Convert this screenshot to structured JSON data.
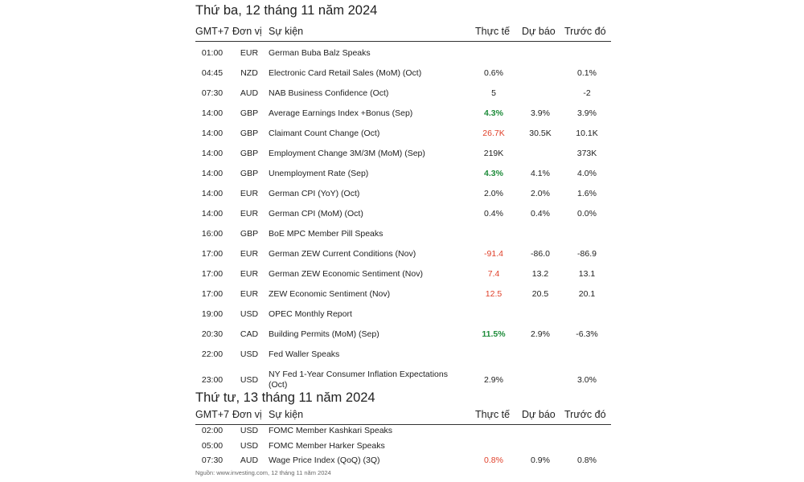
{
  "day1": {
    "title": "Thứ ba, 12 tháng 11 năm 2024",
    "headers": {
      "time": "GMT+7",
      "unit": "Đơn vị",
      "event": "Sự kiện",
      "actual": "Thực tế",
      "forecast": "Dự báo",
      "previous": "Trước đó"
    },
    "rows": [
      {
        "time": "01:00",
        "unit": "EUR",
        "event": "German Buba Balz Speaks",
        "actual": "",
        "actual_trend": "",
        "forecast": "",
        "previous": ""
      },
      {
        "time": "04:45",
        "unit": "NZD",
        "event": "Electronic Card Retail Sales (MoM) (Oct)",
        "actual": "0.6%",
        "actual_trend": "",
        "forecast": "",
        "previous": "0.1%"
      },
      {
        "time": "07:30",
        "unit": "AUD",
        "event": "NAB Business Confidence (Oct)",
        "actual": "5",
        "actual_trend": "",
        "forecast": "",
        "previous": "-2"
      },
      {
        "time": "14:00",
        "unit": "GBP",
        "event": "Average Earnings Index +Bonus (Sep)",
        "actual": "4.3%",
        "actual_trend": "up",
        "forecast": "3.9%",
        "previous": "3.9%"
      },
      {
        "time": "14:00",
        "unit": "GBP",
        "event": "Claimant Count Change (Oct)",
        "actual": "26.7K",
        "actual_trend": "down",
        "forecast": "30.5K",
        "previous": "10.1K"
      },
      {
        "time": "14:00",
        "unit": "GBP",
        "event": "Employment Change 3M/3M (MoM) (Sep)",
        "actual": "219K",
        "actual_trend": "",
        "forecast": "",
        "previous": "373K"
      },
      {
        "time": "14:00",
        "unit": "GBP",
        "event": "Unemployment Rate (Sep)",
        "actual": "4.3%",
        "actual_trend": "up",
        "forecast": "4.1%",
        "previous": "4.0%"
      },
      {
        "time": "14:00",
        "unit": "EUR",
        "event": "German CPI (YoY) (Oct)",
        "actual": "2.0%",
        "actual_trend": "",
        "forecast": "2.0%",
        "previous": "1.6%"
      },
      {
        "time": "14:00",
        "unit": "EUR",
        "event": "German CPI (MoM) (Oct)",
        "actual": "0.4%",
        "actual_trend": "",
        "forecast": "0.4%",
        "previous": "0.0%"
      },
      {
        "time": "16:00",
        "unit": "GBP",
        "event": "BoE MPC Member Pill Speaks",
        "actual": "",
        "actual_trend": "",
        "forecast": "",
        "previous": ""
      },
      {
        "time": "17:00",
        "unit": "EUR",
        "event": "German ZEW Current Conditions (Nov)",
        "actual": "-91.4",
        "actual_trend": "down",
        "forecast": "-86.0",
        "previous": "-86.9"
      },
      {
        "time": "17:00",
        "unit": "EUR",
        "event": "German ZEW Economic Sentiment (Nov)",
        "actual": "7.4",
        "actual_trend": "down",
        "forecast": "13.2",
        "previous": "13.1"
      },
      {
        "time": "17:00",
        "unit": "EUR",
        "event": "ZEW Economic Sentiment (Nov)",
        "actual": "12.5",
        "actual_trend": "down",
        "forecast": "20.5",
        "previous": "20.1"
      },
      {
        "time": "19:00",
        "unit": "USD",
        "event": "OPEC Monthly Report",
        "actual": "",
        "actual_trend": "",
        "forecast": "",
        "previous": ""
      },
      {
        "time": "20:30",
        "unit": "CAD",
        "event": "Building Permits (MoM) (Sep)",
        "actual": "11.5%",
        "actual_trend": "up",
        "forecast": "2.9%",
        "previous": "-6.3%"
      },
      {
        "time": "22:00",
        "unit": "USD",
        "event": "Fed Waller Speaks",
        "actual": "",
        "actual_trend": "",
        "forecast": "",
        "previous": ""
      },
      {
        "time": "23:00",
        "unit": "USD",
        "event": "NY Fed 1-Year Consumer Inflation Expectations (Oct)",
        "actual": "2.9%",
        "actual_trend": "",
        "forecast": "",
        "previous": "3.0%"
      }
    ]
  },
  "day2": {
    "title": "Thứ tư, 13 tháng 11 năm 2024",
    "headers": {
      "time": "GMT+7",
      "unit": "Đơn vị",
      "event": "Sự kiện",
      "actual": "Thực tế",
      "forecast": "Dự báo",
      "previous": "Trước đó"
    },
    "rows": [
      {
        "time": "02:00",
        "unit": "USD",
        "event": "FOMC Member Kashkari Speaks",
        "actual": "",
        "actual_trend": "",
        "forecast": "",
        "previous": ""
      },
      {
        "time": "05:00",
        "unit": "USD",
        "event": "FOMC Member Harker Speaks",
        "actual": "",
        "actual_trend": "",
        "forecast": "",
        "previous": ""
      },
      {
        "time": "07:30",
        "unit": "AUD",
        "event": "Wage Price Index (QoQ) (3Q)",
        "actual": "0.8%",
        "actual_trend": "down",
        "forecast": "0.9%",
        "previous": "0.8%"
      }
    ]
  },
  "source": "Nguồn: www.investing.com, 12 tháng 11 năm 2024",
  "colors": {
    "up": "#1e8c3a",
    "down": "#e0402a"
  }
}
